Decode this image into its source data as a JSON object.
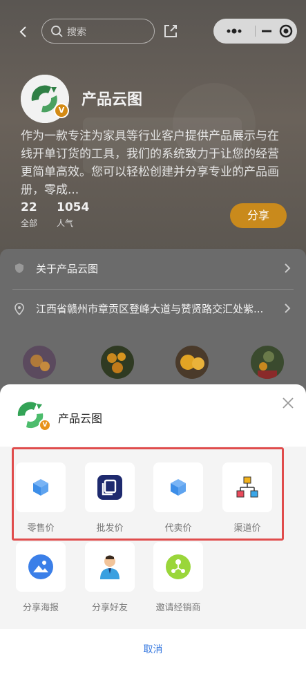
{
  "nav": {
    "search_placeholder": "搜索",
    "icons": [
      "back-icon",
      "search-icon",
      "share-icon",
      "more-dots-icon",
      "minimize-icon",
      "close-target-icon"
    ]
  },
  "store": {
    "name": "产品云图",
    "badge": "V",
    "description": "作为一款专注为家具等行业客户提供产品展示与在线开单订货的工具，我们的系统致力于让您的经营更简单高效。您可以轻松创建并分享专业的产品画册，零成...",
    "stats": [
      {
        "value": "22",
        "label": "全部"
      },
      {
        "value": "1054",
        "label": "人气"
      }
    ],
    "share_label": "分享"
  },
  "info": {
    "about_label": "关于产品云图",
    "address": "江西省赣州市章贡区登峰大道与赞贤路交汇处紫..."
  },
  "sheet": {
    "title": "产品云图",
    "badge": "V",
    "price_options": [
      {
        "label": "零售价",
        "icon": "cube-icon"
      },
      {
        "label": "批发价",
        "icon": "copy-icon"
      },
      {
        "label": "代卖价",
        "icon": "cube-icon"
      },
      {
        "label": "渠道价",
        "icon": "org-chart-icon"
      }
    ],
    "share_options": [
      {
        "label": "分享海报",
        "icon": "poster-icon"
      },
      {
        "label": "分享好友",
        "icon": "person-icon"
      },
      {
        "label": "邀请经销商",
        "icon": "network-icon"
      }
    ],
    "cancel_label": "取消"
  },
  "colors": {
    "accent_blue": "#3a7be0",
    "share_orange": "#c98a1c",
    "highlight_red": "#e04c4c",
    "brand_green": "#3aa35a"
  }
}
